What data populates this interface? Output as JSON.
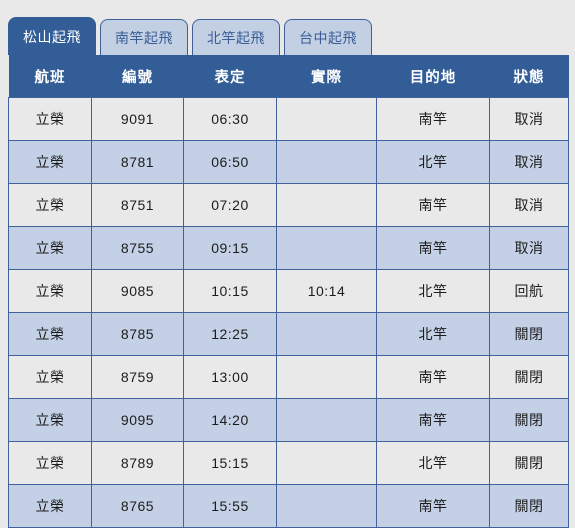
{
  "colors": {
    "accent_blue": "#325d96",
    "border_blue": "#41629a",
    "tab_inactive_bg": "#c3d0e4",
    "row_alt_bg": "#c3d0e6",
    "row_bg": "#e9e9e9",
    "page_bg": "#e9e9e9"
  },
  "tabs": [
    {
      "label": "松山起飛",
      "active": true
    },
    {
      "label": "南竿起飛",
      "active": false
    },
    {
      "label": "北竿起飛",
      "active": false
    },
    {
      "label": "台中起飛",
      "active": false
    }
  ],
  "table": {
    "columns": [
      {
        "key": "airline",
        "label": "航班"
      },
      {
        "key": "number",
        "label": "編號"
      },
      {
        "key": "scheduled",
        "label": "表定"
      },
      {
        "key": "actual",
        "label": "實際"
      },
      {
        "key": "destination",
        "label": "目的地"
      },
      {
        "key": "status",
        "label": "狀態"
      }
    ],
    "rows": [
      {
        "airline": "立榮",
        "number": "9091",
        "scheduled": "06:30",
        "actual": "",
        "destination": "南竿",
        "status": "取消"
      },
      {
        "airline": "立榮",
        "number": "8781",
        "scheduled": "06:50",
        "actual": "",
        "destination": "北竿",
        "status": "取消"
      },
      {
        "airline": "立榮",
        "number": "8751",
        "scheduled": "07:20",
        "actual": "",
        "destination": "南竿",
        "status": "取消"
      },
      {
        "airline": "立榮",
        "number": "8755",
        "scheduled": "09:15",
        "actual": "",
        "destination": "南竿",
        "status": "取消"
      },
      {
        "airline": "立榮",
        "number": "9085",
        "scheduled": "10:15",
        "actual": "10:14",
        "destination": "北竿",
        "status": "回航"
      },
      {
        "airline": "立榮",
        "number": "8785",
        "scheduled": "12:25",
        "actual": "",
        "destination": "北竿",
        "status": "關閉"
      },
      {
        "airline": "立榮",
        "number": "8759",
        "scheduled": "13:00",
        "actual": "",
        "destination": "南竿",
        "status": "關閉"
      },
      {
        "airline": "立榮",
        "number": "9095",
        "scheduled": "14:20",
        "actual": "",
        "destination": "南竿",
        "status": "關閉"
      },
      {
        "airline": "立榮",
        "number": "8789",
        "scheduled": "15:15",
        "actual": "",
        "destination": "北竿",
        "status": "關閉"
      },
      {
        "airline": "立榮",
        "number": "8765",
        "scheduled": "15:55",
        "actual": "",
        "destination": "南竿",
        "status": "關閉"
      }
    ]
  }
}
